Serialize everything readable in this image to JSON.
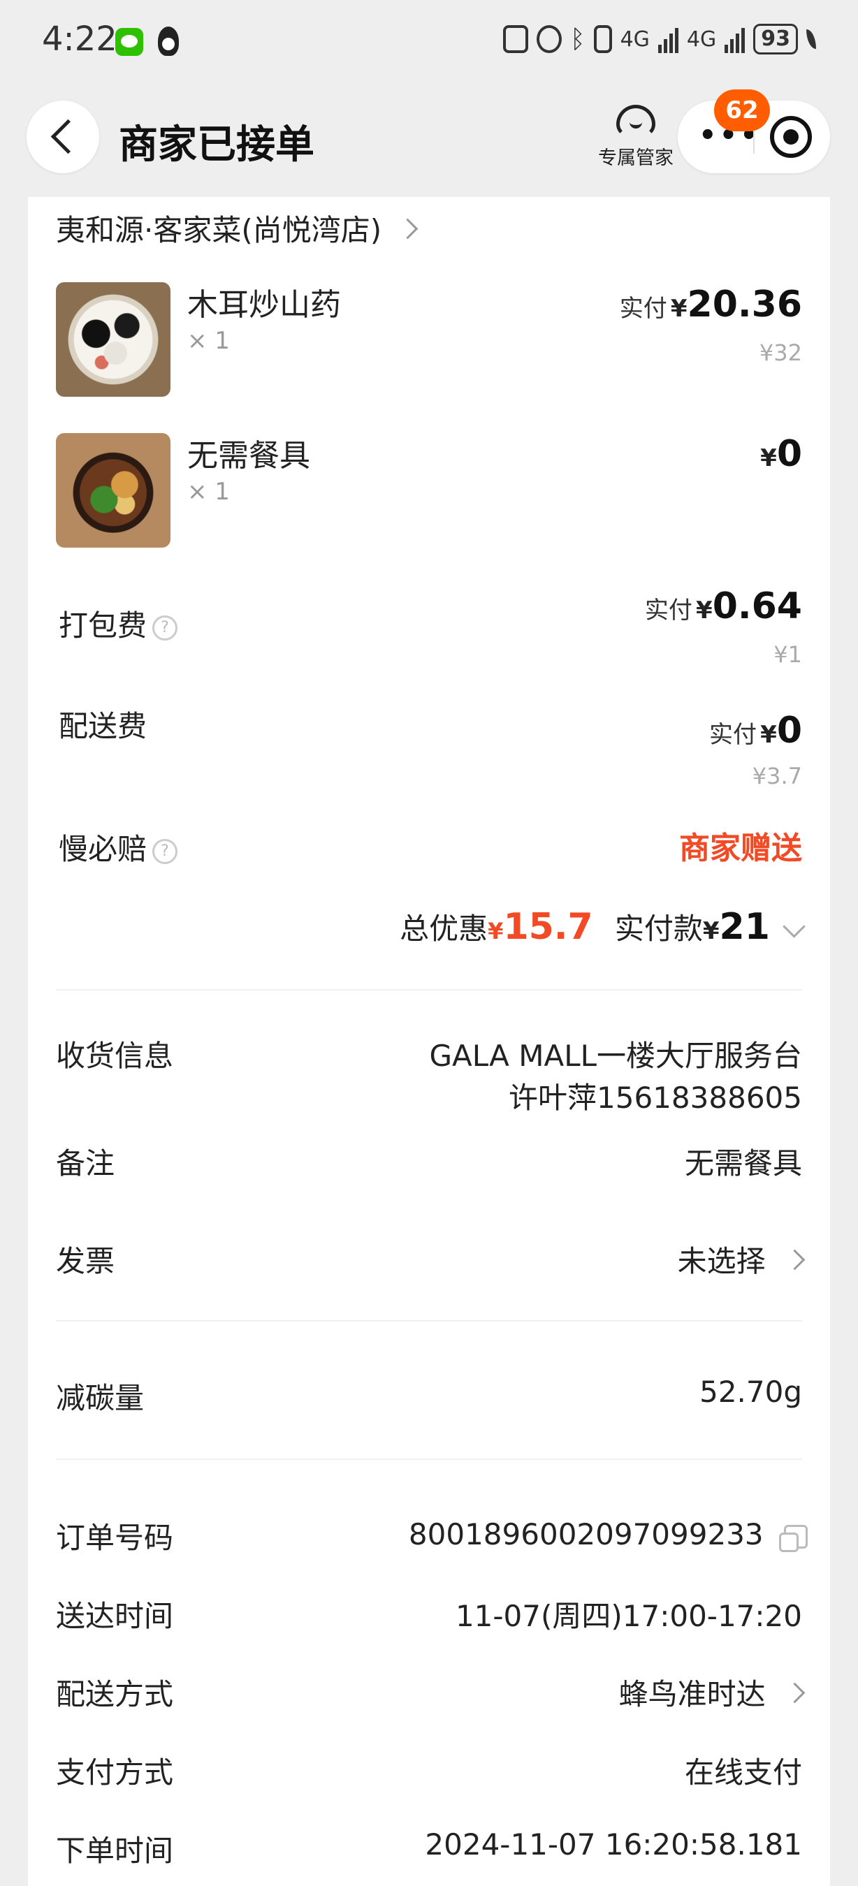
{
  "status_bar": {
    "time": "4:22",
    "net1": "4G",
    "net2": "4G",
    "battery": "93",
    "icons": [
      "wechat-icon",
      "qq-icon",
      "nfc-icon",
      "alarm-icon",
      "bluetooth-icon",
      "vibrate-icon",
      "signal-icon",
      "battery-icon",
      "leaf-icon"
    ]
  },
  "header": {
    "title": "商家已接单",
    "manager_label": "专属管家",
    "badge_count": "62"
  },
  "shop": {
    "name": "夷和源·客家菜(尚悦湾店)"
  },
  "items": [
    {
      "name": "木耳炒山药",
      "qty": "× 1",
      "paid_label": "实付",
      "currency": "¥",
      "price": "20.36",
      "original": "¥32"
    },
    {
      "name": "无需餐具",
      "qty": "× 1",
      "currency": "¥",
      "price": "0"
    }
  ],
  "fees": {
    "packing": {
      "label": "打包费",
      "paid_label": "实付",
      "currency": "¥",
      "price": "0.64",
      "original": "¥1"
    },
    "delivery": {
      "label": "配送费",
      "paid_label": "实付",
      "currency": "¥",
      "price": "0",
      "original": "¥3.7"
    },
    "late_comp": {
      "label": "慢必赔",
      "value": "商家赠送"
    }
  },
  "summary": {
    "discount_label": "总优惠",
    "discount_currency": "¥",
    "discount_value": "15.7",
    "paid_label": "实付款",
    "paid_currency": "¥",
    "paid_value": "21"
  },
  "delivery_info": {
    "label": "收货信息",
    "address": "GALA MALL一楼大厅服务台",
    "contact": "许叶萍15618388605"
  },
  "remark": {
    "label": "备注",
    "value": "无需餐具"
  },
  "invoice": {
    "label": "发票",
    "value": "未选择"
  },
  "carbon": {
    "label": "减碳量",
    "value": "52.70g"
  },
  "order": {
    "number_label": "订单号码",
    "number": "8001896002097099233",
    "arrive_label": "送达时间",
    "arrive": "11-07(周四)17:00-17:20",
    "method_label": "配送方式",
    "method": "蜂鸟准时达",
    "pay_label": "支付方式",
    "pay": "在线支付",
    "created_label": "下单时间",
    "created": "2024-11-07 16:20:58.181"
  },
  "colors": {
    "accent": "#f24a24",
    "badge": "#ff5d00"
  }
}
